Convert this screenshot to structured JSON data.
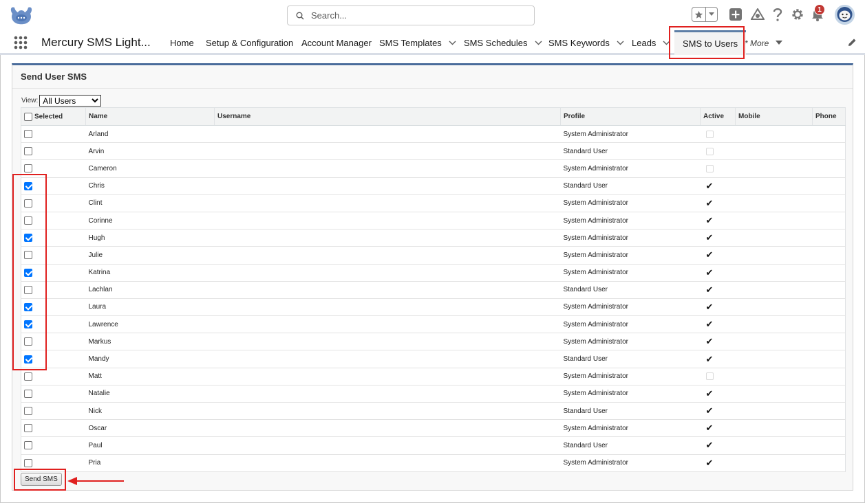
{
  "header": {
    "search_placeholder": "Search...",
    "notification_count": "1",
    "icons": [
      "cloud-logo-icon",
      "search-icon",
      "star-icon",
      "chevron-down-icon",
      "add-icon",
      "trailhead-icon",
      "help-icon",
      "gear-icon",
      "bell-icon",
      "avatar-icon"
    ]
  },
  "nav": {
    "app_name": "Mercury SMS Light...",
    "tabs": [
      {
        "label": "Home",
        "dropdown": false
      },
      {
        "label": "Setup & Configuration",
        "dropdown": false
      },
      {
        "label": "Account Manager",
        "dropdown": false
      },
      {
        "label": "SMS Templates",
        "dropdown": true
      },
      {
        "label": "SMS Schedules",
        "dropdown": true
      },
      {
        "label": "SMS Keywords",
        "dropdown": true
      },
      {
        "label": "Leads",
        "dropdown": true
      },
      {
        "label": "SMS to Users",
        "dropdown": false,
        "active": true
      }
    ],
    "more_label": "* More"
  },
  "panel": {
    "title": "Send User SMS",
    "view_label": "View:",
    "view_selected": "All Users",
    "columns": [
      "Selected",
      "Name",
      "Username",
      "Profile",
      "Active",
      "Mobile",
      "Phone"
    ],
    "rows": [
      {
        "selected": false,
        "name": "Arland",
        "profile": "System Administrator",
        "active": false
      },
      {
        "selected": false,
        "name": "Arvin",
        "profile": "Standard User",
        "active": false
      },
      {
        "selected": false,
        "name": "Cameron",
        "profile": "System Administrator",
        "active": false
      },
      {
        "selected": true,
        "name": "Chris",
        "profile": "Standard User",
        "active": true
      },
      {
        "selected": false,
        "name": "Clint",
        "profile": "System Administrator",
        "active": true
      },
      {
        "selected": false,
        "name": "Corinne",
        "profile": "System Administrator",
        "active": true
      },
      {
        "selected": true,
        "name": "Hugh",
        "profile": "System Administrator",
        "active": true
      },
      {
        "selected": false,
        "name": "Julie",
        "profile": "System Administrator",
        "active": true
      },
      {
        "selected": true,
        "name": "Katrina",
        "profile": "System Administrator",
        "active": true
      },
      {
        "selected": false,
        "name": "Lachlan",
        "profile": "Standard User",
        "active": true
      },
      {
        "selected": true,
        "name": "Laura",
        "profile": "System Administrator",
        "active": true
      },
      {
        "selected": true,
        "name": "Lawrence",
        "profile": "System Administrator",
        "active": true
      },
      {
        "selected": false,
        "name": "Markus",
        "profile": "System Administrator",
        "active": true
      },
      {
        "selected": true,
        "name": "Mandy",
        "profile": "Standard User",
        "active": true
      },
      {
        "selected": false,
        "name": "Matt",
        "profile": "System Administrator",
        "active": false
      },
      {
        "selected": false,
        "name": "Natalie",
        "profile": "System Administrator",
        "active": true
      },
      {
        "selected": false,
        "name": "Nick",
        "profile": "Standard User",
        "active": true
      },
      {
        "selected": false,
        "name": "Oscar",
        "profile": "System Administrator",
        "active": true
      },
      {
        "selected": false,
        "name": "Paul",
        "profile": "Standard User",
        "active": true
      },
      {
        "selected": false,
        "name": "Pria",
        "profile": "System Administrator",
        "active": true
      }
    ],
    "send_button": "Send SMS"
  },
  "colors": {
    "highlight": "#e0201f",
    "checkbox_checked": "#0075ff",
    "panel_border": "#4a6c9b",
    "notification": "#c23934"
  }
}
